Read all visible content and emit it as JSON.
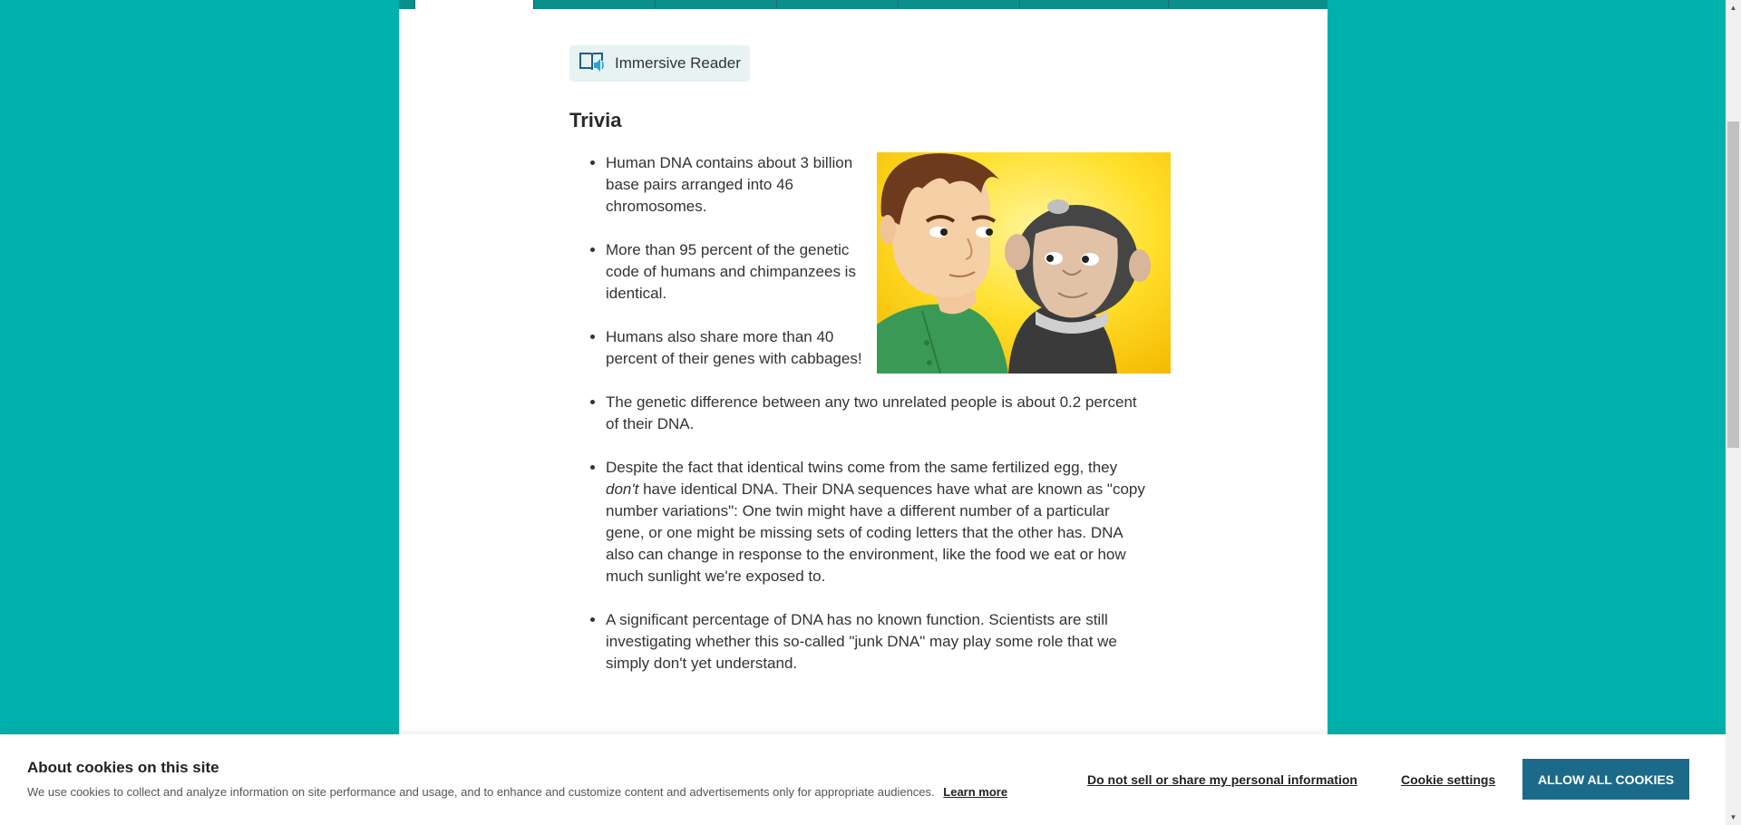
{
  "immersive_reader": {
    "label": "Immersive Reader",
    "icon": "immersive-reader-icon"
  },
  "section": {
    "title": "Trivia"
  },
  "trivia": [
    {
      "text": "Human DNA contains about 3 billion base pairs arranged into 46 chromosomes."
    },
    {
      "text": "More than 95 percent of the genetic code of humans and chimpanzees is identical."
    },
    {
      "text": "Humans also share more than 40 percent of their genes with cabbages!"
    },
    {
      "text": "The genetic difference between any two unrelated people is about 0.2 percent of their DNA."
    },
    {
      "text_before": "Despite the fact that identical twins come from the same fertilized egg, they ",
      "emphasis": "don't",
      "text_after": " have identical DNA. Their DNA sequences have what are known as \"copy number variations\": One twin might have a different number of a particular gene, or one might be missing sets of coding letters that the other has. DNA also can change in response to the environment, like the food we eat or how much sunlight we're exposed to."
    },
    {
      "text": "A significant percentage of DNA has no known function. Scientists are still investigating whether this so-called \"junk DNA\" may play some role that we simply don't yet understand."
    }
  ],
  "cookies": {
    "title": "About cookies on this site",
    "text": "We use cookies to collect and analyze information on site performance and usage, and to enhance and customize content and advertisements only for appropriate audiences.",
    "learn_more": "Learn more",
    "do_not_sell": "Do not sell or share my personal information",
    "settings": "Cookie settings",
    "allow_all": "ALLOW ALL COOKIES"
  },
  "colors": {
    "page_background": "#00b0ad",
    "tab_bar": "#0a8f8c",
    "accent_button": "#1c6a8a",
    "immersive_reader_bg": "#e6f3f2"
  }
}
